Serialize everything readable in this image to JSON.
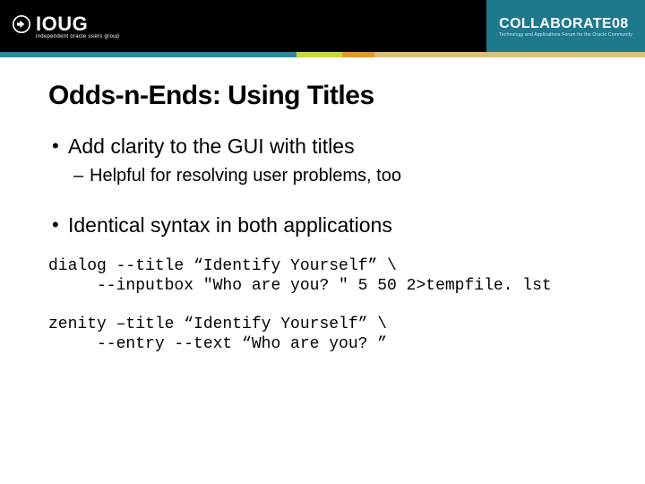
{
  "header": {
    "logo_text": "IOUG",
    "logo_sub": "independent oracle users group",
    "collab_title": "COLLABORATE08",
    "collab_sub": "Technology and Applications Forum for the Oracle Community"
  },
  "slide": {
    "title": "Odds-n-Ends: Using Titles",
    "bullets": [
      {
        "text": "Add clarity to the GUI with titles"
      },
      {
        "text": "Identical syntax in both applications"
      }
    ],
    "sub_bullet": "Helpful for resolving user problems, too",
    "code1": "dialog --title “Identify Yourself” \\\n     --inputbox \"Who are you? \" 5 50 2>tempfile. lst",
    "code2": "zenity –title “Identify Yourself” \\\n     --entry --text “Who are you? ”"
  }
}
